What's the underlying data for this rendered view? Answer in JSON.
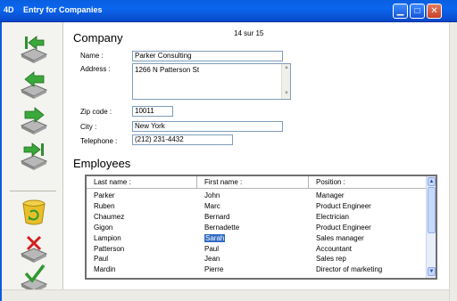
{
  "window": {
    "title": "Entry for Companies",
    "app_icon_text": "4D",
    "buttons": [
      "minimize",
      "maximize",
      "close"
    ],
    "colors": {
      "titlebar": "#0b66ee",
      "selection": "#316ac5"
    }
  },
  "toolbar": {
    "buttons": [
      {
        "name": "first-record",
        "icon": "first-record-icon"
      },
      {
        "name": "previous-record",
        "icon": "previous-record-icon"
      },
      {
        "name": "next-record",
        "icon": "next-record-icon"
      },
      {
        "name": "last-record",
        "icon": "last-record-icon"
      },
      {
        "name": "delete-record",
        "icon": "trash-icon"
      },
      {
        "name": "cancel",
        "icon": "cancel-icon"
      },
      {
        "name": "accept",
        "icon": "checkmark-icon"
      }
    ]
  },
  "company": {
    "heading": "Company",
    "record_position": "14 sur 15",
    "name_label": "Name :",
    "name_value": "Parker Consulting",
    "address_label": "Address :",
    "address_value": "1266 N Patterson St",
    "zip_label": "Zip code :",
    "zip_value": "10011",
    "city_label": "City :",
    "city_value": "New York",
    "phone_label": "Telephone :",
    "phone_value": "(212) 231-4432"
  },
  "employees": {
    "heading": "Employees",
    "columns": [
      "Last name :",
      "First name :",
      "Position :"
    ],
    "selected_row": 4,
    "rows": [
      [
        "Parker",
        "John",
        "Manager"
      ],
      [
        "Ruben",
        "Marc",
        "Product Engineer"
      ],
      [
        "Chaumez",
        "Bernard",
        "Electrician"
      ],
      [
        "Gigon",
        "Bernadette",
        "Product Engineer"
      ],
      [
        "Lampion",
        "Sarah",
        "Sales manager"
      ],
      [
        "Patterson",
        "Paul",
        "Accountant"
      ],
      [
        "Paul",
        "Jean",
        "Sales rep"
      ],
      [
        "Mardin",
        "Pierre",
        "Director of marketing"
      ]
    ]
  }
}
